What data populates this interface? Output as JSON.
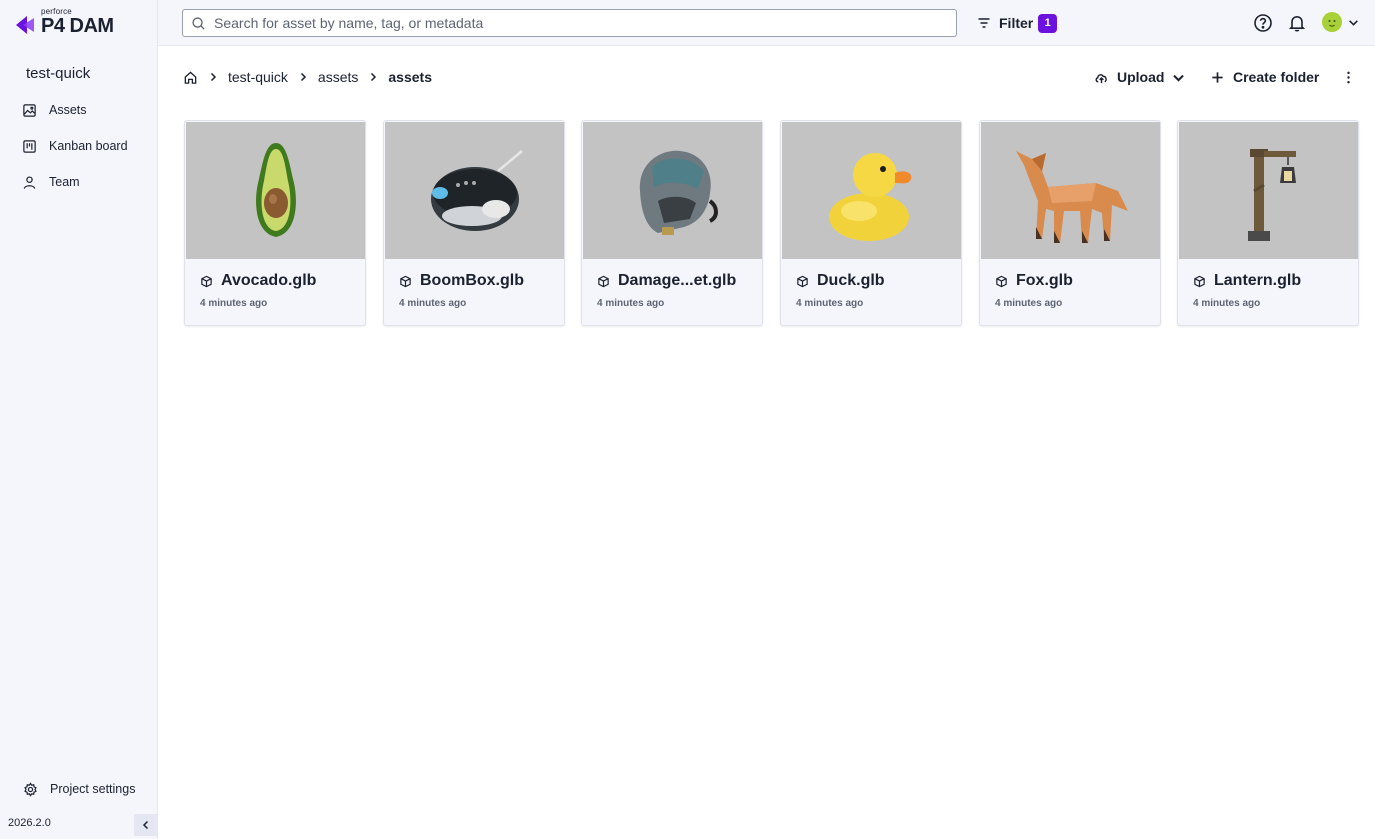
{
  "brand": {
    "small": "perforce",
    "name": "P4 DAM",
    "accent": "#6b11e0"
  },
  "sidebar": {
    "project": "test-quick",
    "items": [
      {
        "label": "Assets",
        "icon": "image-icon"
      },
      {
        "label": "Kanban board",
        "icon": "kanban-icon"
      },
      {
        "label": "Team",
        "icon": "person-icon"
      }
    ],
    "settings_label": "Project settings",
    "version": "2026.2.0"
  },
  "topbar": {
    "search_placeholder": "Search for asset by name, tag, or metadata",
    "filter_label": "Filter",
    "filter_count": "1"
  },
  "breadcrumb": {
    "items": [
      "test-quick",
      "assets"
    ],
    "current": "assets"
  },
  "toolbar": {
    "upload_label": "Upload",
    "create_folder_label": "Create folder"
  },
  "assets": [
    {
      "name": "Avocado.glb",
      "time": "4 minutes ago"
    },
    {
      "name": "BoomBox.glb",
      "time": "4 minutes ago"
    },
    {
      "name": "Damage...et.glb",
      "time": "4 minutes ago"
    },
    {
      "name": "Duck.glb",
      "time": "4 minutes ago"
    },
    {
      "name": "Fox.glb",
      "time": "4 minutes ago"
    },
    {
      "name": "Lantern.glb",
      "time": "4 minutes ago"
    }
  ]
}
